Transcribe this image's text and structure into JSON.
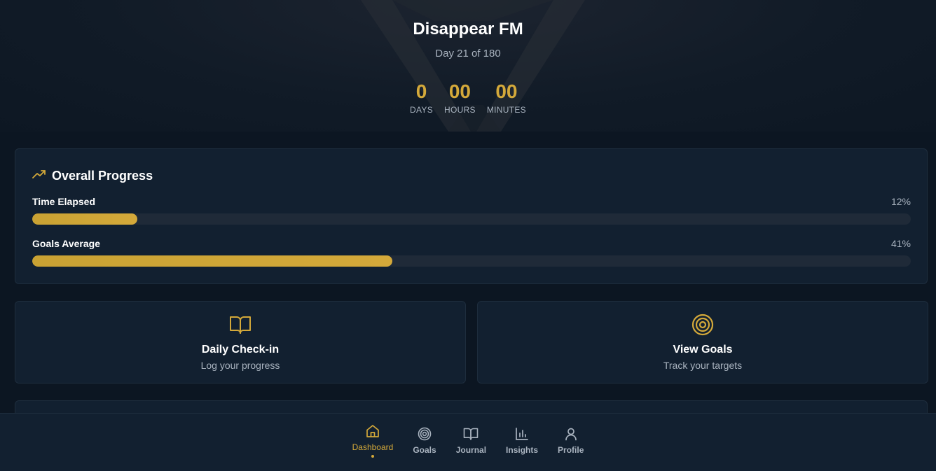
{
  "hero": {
    "title": "Disappear FM",
    "subtitle": "Day 21 of 180",
    "countdown": [
      {
        "value": "0",
        "label": "DAYS"
      },
      {
        "value": "00",
        "label": "HOURS"
      },
      {
        "value": "00",
        "label": "MINUTES"
      }
    ]
  },
  "progress": {
    "icon": "trending-up-icon",
    "title": "Overall Progress",
    "metrics": [
      {
        "label": "Time Elapsed",
        "value_text": "12%",
        "fraction": 0.12
      },
      {
        "label": "Goals Average",
        "value_text": "41%",
        "fraction": 0.41
      }
    ]
  },
  "actions": [
    {
      "icon": "book-open-icon",
      "title": "Daily Check-in",
      "subtitle": "Log your progress"
    },
    {
      "icon": "target-icon",
      "title": "View Goals",
      "subtitle": "Track your targets"
    }
  ],
  "nav": {
    "items": [
      {
        "icon": "home-icon",
        "label": "Dashboard",
        "active": true
      },
      {
        "icon": "target-icon",
        "label": "Goals",
        "active": false
      },
      {
        "icon": "book-open-icon",
        "label": "Journal",
        "active": false
      },
      {
        "icon": "bar-chart-icon",
        "label": "Insights",
        "active": false
      },
      {
        "icon": "user-icon",
        "label": "Profile",
        "active": false
      }
    ]
  },
  "colors": {
    "accent": "#d4a93a",
    "background": "#0c1622",
    "card": "#122030",
    "track": "#1f2a38",
    "muted_text": "#a9b3bf"
  }
}
